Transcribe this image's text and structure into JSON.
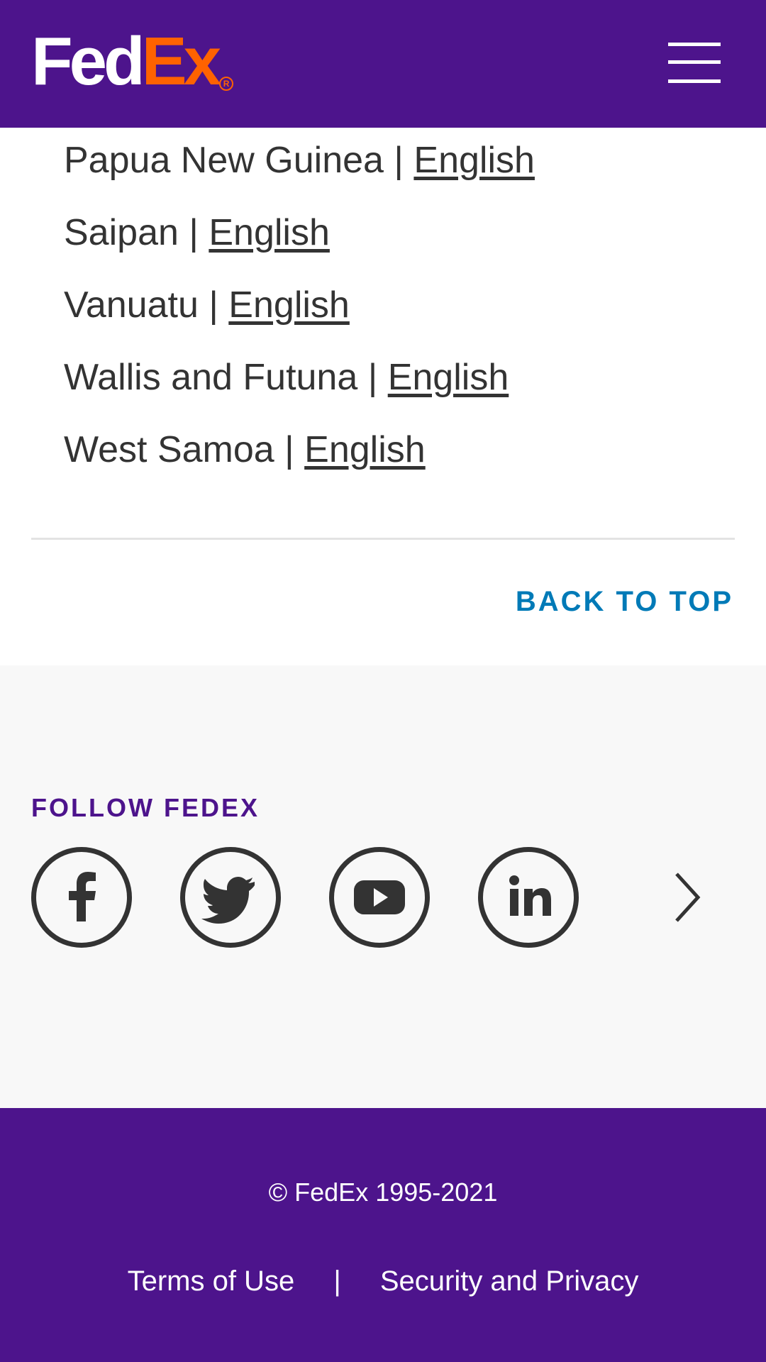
{
  "header": {
    "logo_part1": "Fed",
    "logo_part2": "Ex",
    "logo_mark": "R",
    "menu_icon": "hamburger-menu-icon"
  },
  "countries": [
    {
      "name": "Papua New Guinea",
      "separator": "|",
      "language": "English"
    },
    {
      "name": "Saipan",
      "separator": "|",
      "language": "English"
    },
    {
      "name": "Vanuatu",
      "separator": "|",
      "language": "English"
    },
    {
      "name": "Wallis and Futuna",
      "separator": "|",
      "language": "English"
    },
    {
      "name": "West Samoa",
      "separator": "|",
      "language": "English"
    }
  ],
  "back_to_top": "BACK TO TOP",
  "follow": {
    "title": "FOLLOW FEDEX",
    "icons": [
      "facebook-icon",
      "twitter-icon",
      "youtube-icon",
      "linkedin-icon",
      "chevron-right-icon"
    ]
  },
  "footer": {
    "copyright": "© FedEx 1995-2021",
    "terms": "Terms of Use",
    "divider": "|",
    "privacy": "Security and Privacy"
  },
  "colors": {
    "brand_purple": "#4d148c",
    "brand_orange": "#ff6200",
    "link_blue": "#007ab7",
    "text_dark": "#333333",
    "section_gray": "#f8f8f8"
  }
}
